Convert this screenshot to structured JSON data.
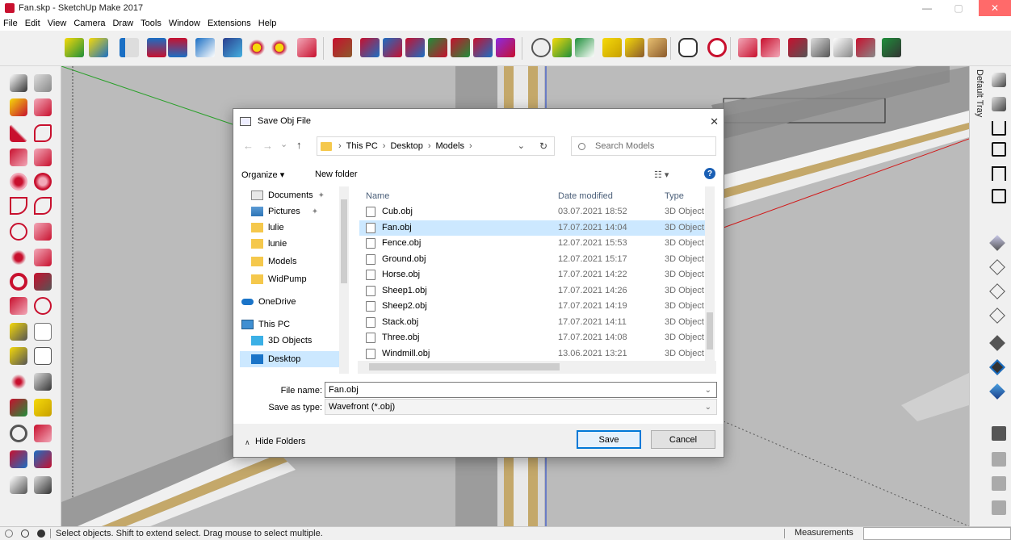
{
  "window": {
    "title": "Fan.skp - SketchUp Make 2017",
    "min_glyph": "—",
    "max_glyph": "▢",
    "close_glyph": "✕"
  },
  "menu": [
    "File",
    "Edit",
    "View",
    "Camera",
    "Draw",
    "Tools",
    "Window",
    "Extensions",
    "Help"
  ],
  "tray": {
    "label": "Default Tray"
  },
  "status": {
    "hint": "Select objects. Shift to extend select. Drag mouse to select multiple.",
    "measurements_label": "Measurements",
    "measurements_value": ""
  },
  "dialog": {
    "title": "Save Obj File",
    "close_glyph": "✕",
    "nav": {
      "back": "←",
      "forward": "→",
      "recent": "⌄",
      "up": "↑",
      "dropdown": "⌄",
      "refresh": "↻"
    },
    "breadcrumb": [
      "This PC",
      "Desktop",
      "Models"
    ],
    "search_placeholder": "Search Models",
    "organize_label": "Organize ▾",
    "new_folder_label": "New folder",
    "view_glyph": "☷ ▾",
    "help_glyph": "?",
    "nav_items": [
      "Documents",
      "Pictures",
      "lulie",
      "lunie",
      "Models",
      "WidPump",
      "OneDrive",
      "This PC",
      "3D Objects",
      "Desktop"
    ],
    "columns": {
      "name": "Name",
      "date": "Date modified",
      "type": "Type"
    },
    "files": [
      {
        "name": "Cub.obj",
        "date": "03.07.2021 18:52",
        "type": "3D Object"
      },
      {
        "name": "Fan.obj",
        "date": "17.07.2021 14:04",
        "type": "3D Object"
      },
      {
        "name": "Fence.obj",
        "date": "12.07.2021 15:53",
        "type": "3D Object"
      },
      {
        "name": "Ground.obj",
        "date": "12.07.2021 15:17",
        "type": "3D Object"
      },
      {
        "name": "Horse.obj",
        "date": "17.07.2021 14:22",
        "type": "3D Object"
      },
      {
        "name": "Sheep1.obj",
        "date": "17.07.2021 14:26",
        "type": "3D Object"
      },
      {
        "name": "Sheep2.obj",
        "date": "17.07.2021 14:19",
        "type": "3D Object"
      },
      {
        "name": "Stack.obj",
        "date": "17.07.2021 14:11",
        "type": "3D Object"
      },
      {
        "name": "Three.obj",
        "date": "17.07.2021 14:08",
        "type": "3D Object"
      },
      {
        "name": "Windmill.obj",
        "date": "13.06.2021 13:21",
        "type": "3D Object"
      }
    ],
    "selected_file": "Fan.obj",
    "file_name_label": "File name:",
    "file_name_value": "Fan.obj",
    "save_type_label": "Save as type:",
    "save_type_value": "Wavefront (*.obj)",
    "hide_folders_label": "Hide Folders",
    "save_label": "Save",
    "cancel_label": "Cancel"
  },
  "colors": {
    "viewport_bg": "#b9b9b9",
    "wall_gold": "#c4a86a",
    "selection": "#cce8ff",
    "close_red": "#e81123",
    "accent": "#0078d7"
  }
}
